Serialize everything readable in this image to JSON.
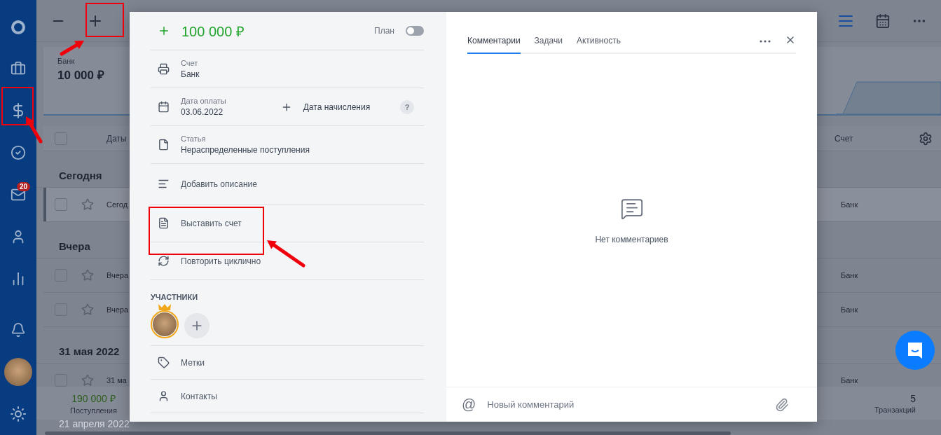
{
  "sidebar": {
    "badge": "20"
  },
  "summary_card": {
    "label": "Банк",
    "amount": "10 000 ₽"
  },
  "table": {
    "columns": [
      "Даты",
      "Счет"
    ],
    "select_all_checked": false,
    "groups": [
      {
        "title": "Сегодня",
        "rows": [
          {
            "date": "Сегод",
            "account": "Банк",
            "selected": true,
            "checked": false
          }
        ]
      },
      {
        "title": "Вчера",
        "rows": [
          {
            "date": "Вчера",
            "account": "Банк",
            "selected": false,
            "checked": false
          },
          {
            "date": "Вчера",
            "account": "Банк",
            "selected": false,
            "checked": false
          }
        ]
      },
      {
        "title": "31 мая 2022",
        "rows": [
          {
            "date": "31 ма",
            "account": "Банк",
            "selected": false,
            "checked": false
          }
        ]
      }
    ]
  },
  "footer": {
    "income": "190 000 ₽",
    "income_label": "Поступления",
    "count": "5",
    "count_label": "Транзакций",
    "next_group": "21 апреля 2022"
  },
  "modal": {
    "amount": "100 000 ₽",
    "plan_label": "План",
    "plan_on": false,
    "fields": [
      {
        "kind": "account",
        "label": "Счет",
        "value": "Банк"
      },
      {
        "kind": "date",
        "label": "Дата оплаты",
        "value": "03.06.2022",
        "extra": "Дата начисления",
        "help": "?"
      },
      {
        "kind": "category",
        "label": "Статья",
        "value": "Нераспределенные поступления"
      }
    ],
    "actions": [
      {
        "kind": "description",
        "label": "Добавить описание"
      },
      {
        "kind": "invoice",
        "label": "Выставить счет"
      },
      {
        "kind": "repeat",
        "label": "Повторить циклично"
      }
    ],
    "participants_title": "УЧАСТНИКИ",
    "extras": [
      {
        "kind": "tags",
        "label": "Метки"
      },
      {
        "kind": "contacts",
        "label": "Контакты"
      }
    ]
  },
  "comments": {
    "tabs": [
      {
        "label": "Комментарии",
        "selected": true
      },
      {
        "label": "Задачи",
        "selected": false
      },
      {
        "label": "Активность",
        "selected": false
      }
    ],
    "empty": "Нет комментариев",
    "mention": "@",
    "input": {
      "placeholder": "Новый комментарий"
    }
  }
}
